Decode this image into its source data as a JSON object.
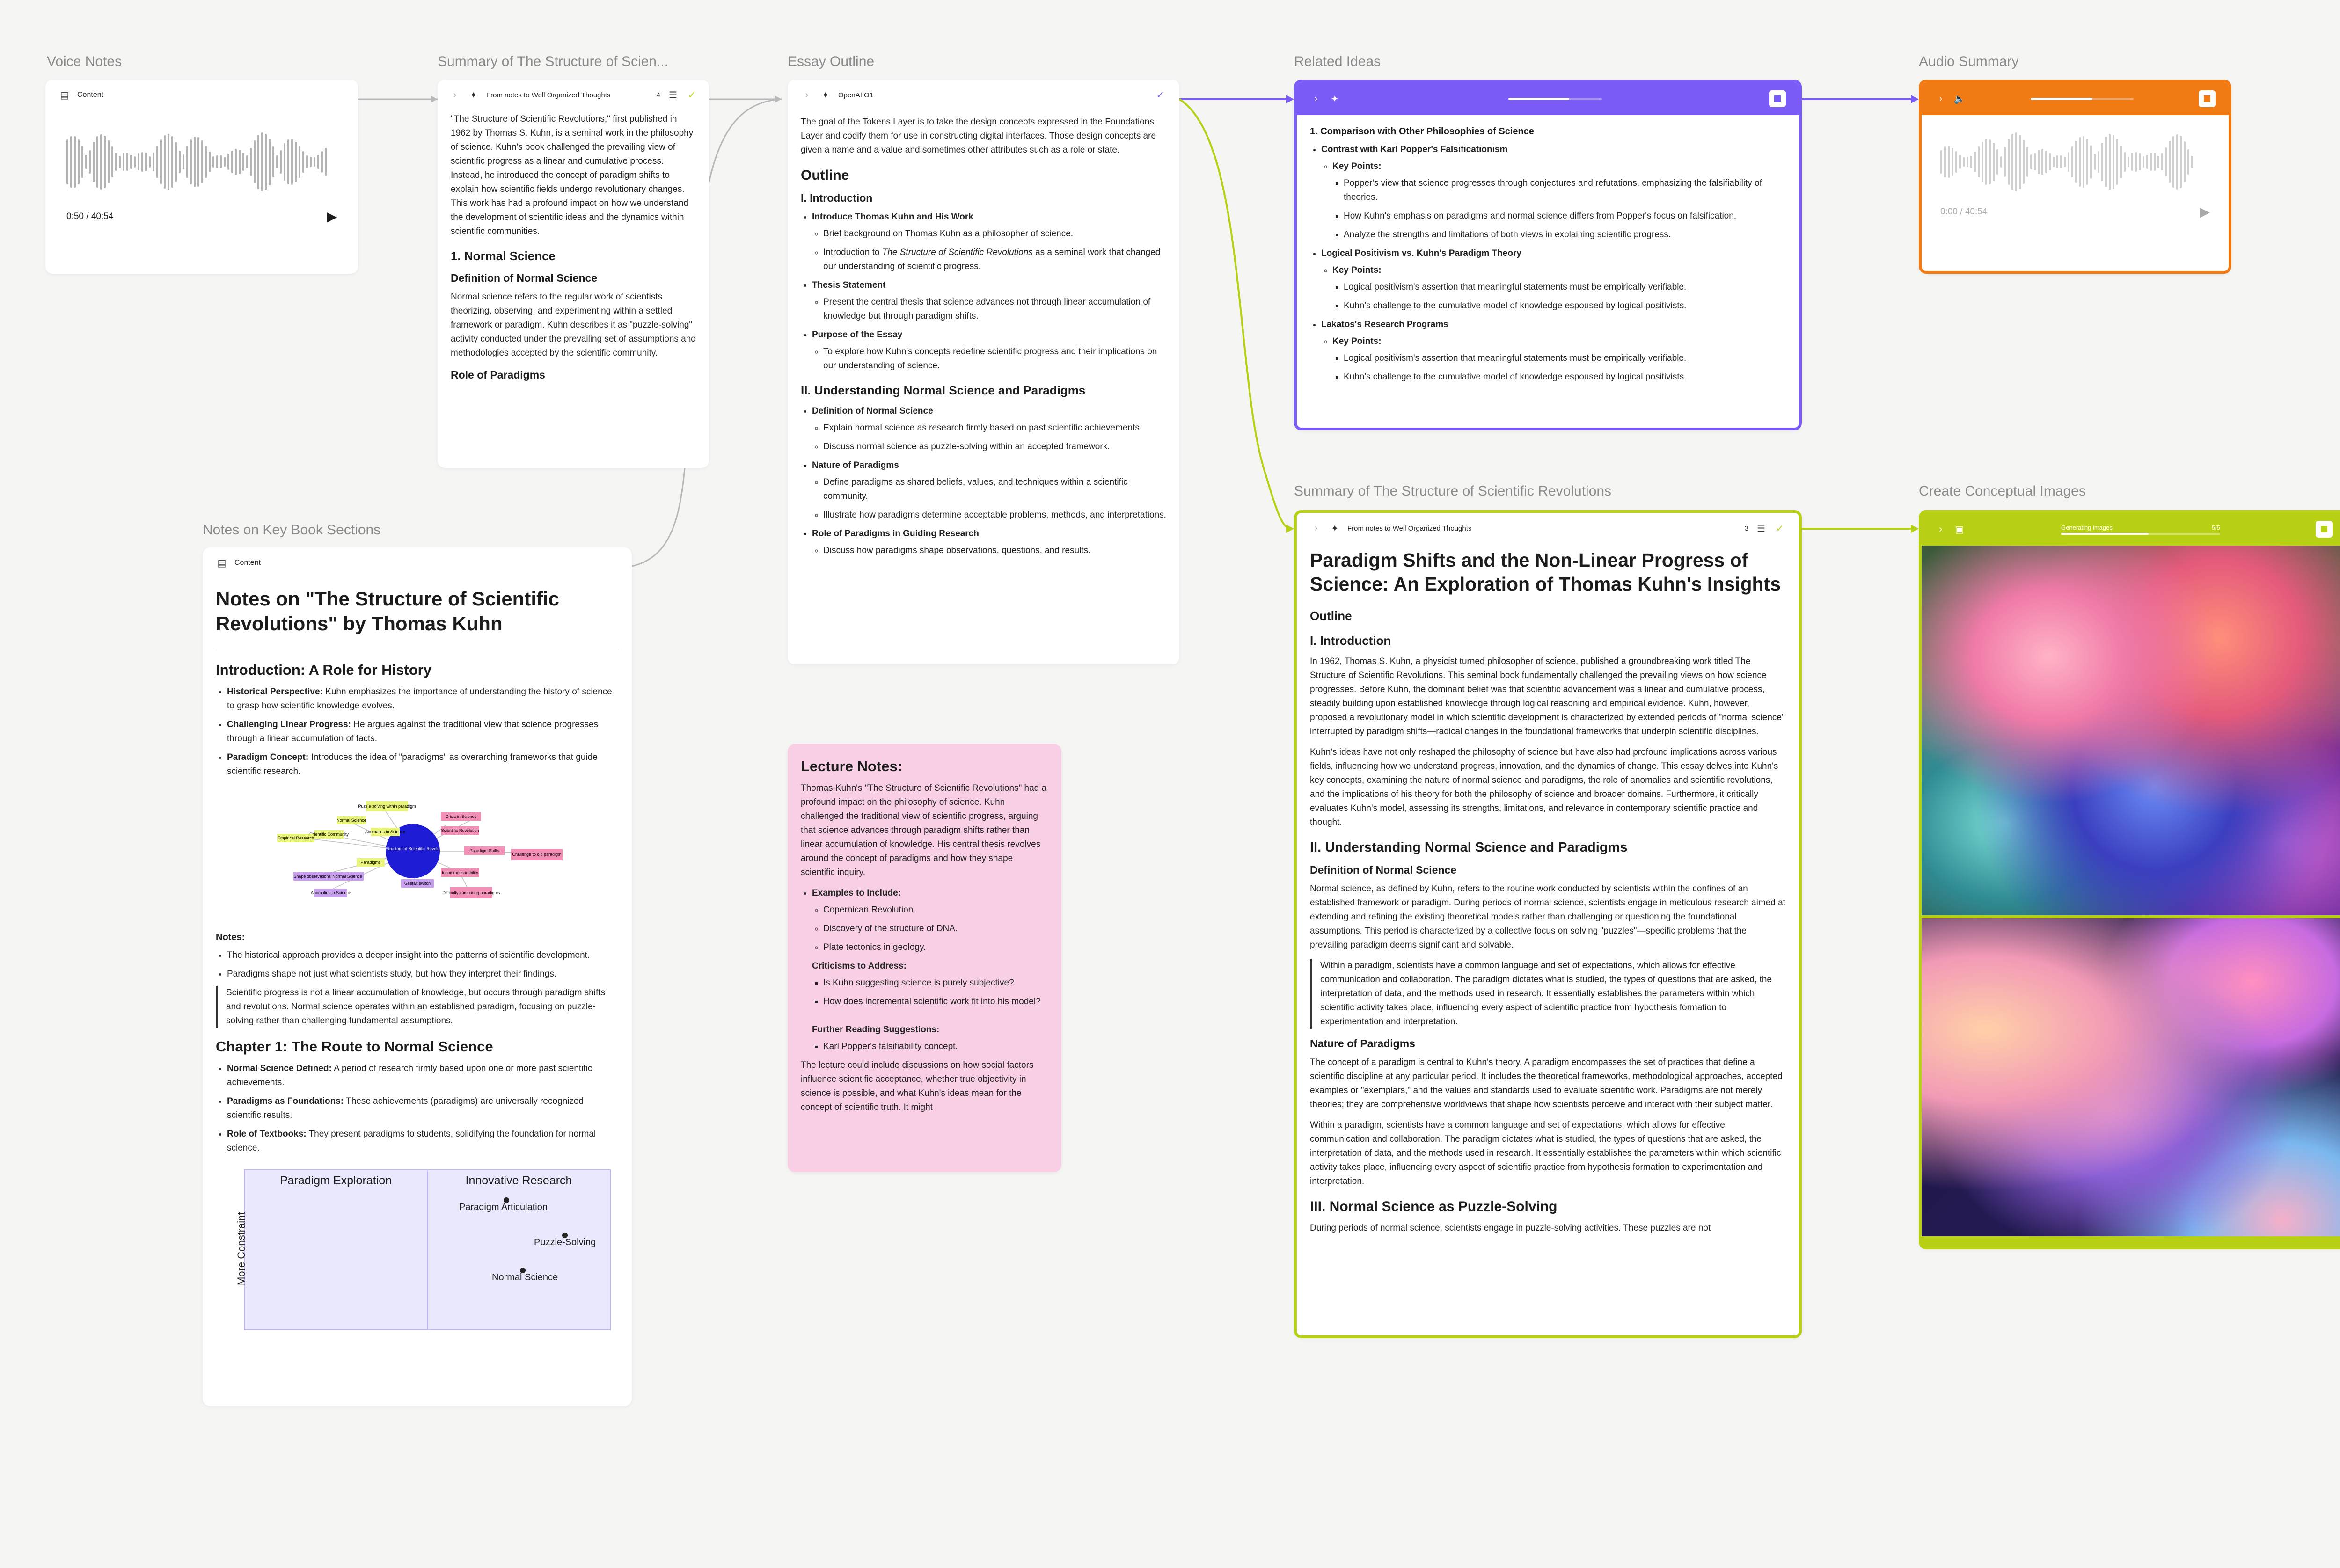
{
  "cards": {
    "voice_notes": {
      "label": "Voice Notes",
      "header": "Content",
      "time": "0:50 / 40:54"
    },
    "summary_small": {
      "label": "Summary of The Structure of Scien...",
      "header": "From notes to Well Organized Thoughts",
      "count": "4",
      "intro": "\"The Structure of Scientific Revolutions,\" first published in 1962 by Thomas S. Kuhn, is a seminal work in the philosophy of science. Kuhn's book challenged the prevailing view of scientific progress as a linear and cumulative process. Instead, he introduced the concept of paradigm shifts to explain how scientific fields undergo revolutionary changes. This work has had a profound impact on how we understand the development of scientific ideas and the dynamics within scientific communities.",
      "h_normal": "1. Normal Science",
      "h_def": "Definition of Normal Science",
      "def_text": "Normal science refers to the regular work of scientists theorizing, observing, and experimenting within a settled framework or paradigm. Kuhn describes it as \"puzzle-solving\" activity conducted under the prevailing set of assumptions and methodologies accepted by the scientific community.",
      "h_role": "Role of Paradigms"
    },
    "essay_outline": {
      "label": "Essay Outline",
      "header": "OpenAI O1",
      "intro": "The goal of the Tokens Layer is to take the design concepts expressed in the Foundations Layer and codify them for use in constructing digital interfaces. Those design concepts are given a name and a value and sometimes other attributes such as a role or state.",
      "h_outline": "Outline",
      "h_intro": "I. Introduction",
      "i1": "Introduce Thomas Kuhn and His Work",
      "i1a": "Brief background on Thomas Kuhn as a philosopher of science.",
      "i1b_pre": "Introduction to ",
      "i1b_em": "The Structure of Scientific Revolutions",
      "i1b_post": " as a seminal work that changed our understanding of scientific progress.",
      "i2": "Thesis Statement",
      "i2a": "Present the central thesis that science advances not through linear accumulation of knowledge but through paradigm shifts.",
      "i3": "Purpose of the Essay",
      "i3a": "To explore how Kuhn's concepts redefine scientific progress and their implications on our understanding of science.",
      "h_ii": "II. Understanding Normal Science and Paradigms",
      "j1": "Definition of Normal Science",
      "j1a": "Explain normal science as research firmly based on past scientific achievements.",
      "j1b": "Discuss normal science as puzzle-solving within an accepted framework.",
      "j2": "Nature of Paradigms",
      "j2a": "Define paradigms as shared beliefs, values, and techniques within a scientific community.",
      "j2b": "Illustrate how paradigms determine acceptable problems, methods, and interpretations.",
      "j3": "Role of Paradigms in Guiding Research",
      "j3a": "Discuss how paradigms shape observations, questions, and results."
    },
    "related_ideas": {
      "label": "Related Ideas",
      "t1": "1. Comparison with Other Philosophies of Science",
      "t1a": "Contrast with Karl Popper's Falsificationism",
      "kp": "Key Points:",
      "t1a1": "Popper's view that science progresses through conjectures and refutations, emphasizing the falsifiability of theories.",
      "t1a2": "How Kuhn's emphasis on paradigms and normal science differs from Popper's focus on falsification.",
      "t1a3": "Analyze the strengths and limitations of both views in explaining scientific progress.",
      "t1b": "Logical Positivism vs. Kuhn's Paradigm Theory",
      "t1b1": "Logical positivism's assertion that meaningful statements must be empirically verifiable.",
      "t1b2": "Kuhn's challenge to the cumulative model of knowledge espoused by logical positivists.",
      "t1c": "Lakatos's Research Programs",
      "t1c1": "Logical positivism's assertion that meaningful statements must be empirically verifiable.",
      "t1c2": "Kuhn's challenge to the cumulative model of knowledge espoused by logical positivists."
    },
    "audio_summary": {
      "label": "Audio Summary",
      "time": "0:00 / 40:54"
    },
    "notes_book": {
      "label": "Notes on Key Book Sections",
      "header": "Content",
      "title": "Notes on \"The Structure of Scientific Revolutions\" by Thomas Kuhn",
      "h_intro": "Introduction: A Role for History",
      "b1k": "Historical Perspective:",
      "b1v": " Kuhn emphasizes the importance of understanding the history of science to grasp how scientific knowledge evolves.",
      "b2k": "Challenging Linear Progress:",
      "b2v": " He argues against the traditional view that science progresses through a linear accumulation of facts.",
      "b3k": "Paradigm Concept:",
      "b3v": " Introduces the idea of \"paradigms\" as overarching frameworks that guide scientific research.",
      "notes_h": "Notes:",
      "n1": "The historical approach provides a deeper insight into the patterns of scientific development.",
      "n2": "Paradigms shape not just what scientists study, but how they interpret their findings.",
      "quote": "Scientific progress is not a linear accumulation of knowledge, but occurs through paradigm shifts and revolutions. Normal science operates within an established paradigm, focusing on puzzle-solving rather than challenging fundamental assumptions.",
      "h_ch1": "Chapter 1: The Route to Normal Science",
      "c1k": "Normal Science Defined:",
      "c1v": " A period of research firmly based upon one or more past scientific achievements.",
      "c2k": "Paradigms as Foundations:",
      "c2v": " These achievements (paradigms) are universally recognized scientific results.",
      "c3k": "Role of Textbooks:",
      "c3v": " They present paradigms to students, solidifying the foundation for normal science.",
      "matrix": {
        "col1": "Paradigm Exploration",
        "col2": "Innovative Research",
        "ylabel": "More Constraint",
        "p1": "Paradigm Articulation",
        "p2": "Puzzle-Solving",
        "p3": "Normal Science"
      },
      "mindmap": {
        "center": "The Structure of Scientific Revolutions",
        "n_a": "Puzzle solving within paradigm",
        "n_b": "Normal Science",
        "n_c": "Anomalies in Science",
        "n_d": "Scientific Community",
        "n_e": "Empirical Research",
        "n_f": "Paradigms",
        "n_g": "Shape observations",
        "n_h": "Crisis in Science",
        "n_i": "Paradigm Shifts",
        "n_j": "Scientific Revolution",
        "n_k": "Challenge to old paradigm",
        "n_l": "Incommensurability",
        "n_m": "Difficulty comparing paradigms",
        "n_n": "Gestalt switch"
      }
    },
    "lecture": {
      "title": "Lecture Notes:",
      "intro": "Thomas Kuhn's \"The Structure of Scientific Revolutions\" had a profound impact on the philosophy of science. Kuhn challenged the traditional view of scientific progress, arguing that science advances through paradigm shifts rather than linear accumulation of knowledge. His central thesis revolves around the concept of paradigms and how they shape scientific inquiry.",
      "ex_h": "Examples to Include:",
      "ex1": "Copernican Revolution.",
      "ex2": "Discovery of the structure of DNA.",
      "ex3": "Plate tectonics in geology.",
      "cr_h": "Criticisms to Address:",
      "cr1": "Is Kuhn suggesting science is purely subjective?",
      "cr2": "How does incremental scientific work fit into his model?",
      "fr_h": "Further Reading Suggestions:",
      "fr1": "Karl Popper's falsifiability concept.",
      "outro": "The lecture could include discussions on how social factors influence scientific acceptance, whether true objectivity in science is possible, and what Kuhn's ideas mean for the concept of scientific truth. It might"
    },
    "summary_big": {
      "label": "Summary of The Structure of Scientific Revolutions",
      "header": "From notes to Well Organized Thoughts",
      "count": "3",
      "title": "Paradigm Shifts and the Non-Linear Progress of Science: An Exploration of Thomas Kuhn's Insights",
      "h_outline": "Outline",
      "h_intro": "I. Introduction",
      "p1": "In 1962, Thomas S. Kuhn, a physicist turned philosopher of science, published a groundbreaking work titled The Structure of Scientific Revolutions. This seminal book fundamentally challenged the prevailing views on how science progresses. Before Kuhn, the dominant belief was that scientific advancement was a linear and cumulative process, steadily building upon established knowledge through logical reasoning and empirical evidence. Kuhn, however, proposed a revolutionary model in which scientific development is characterized by extended periods of \"normal science\" interrupted by paradigm shifts—radical changes in the foundational frameworks that underpin scientific disciplines.",
      "p2": "Kuhn's ideas have not only reshaped the philosophy of science but have also had profound implications across various fields, influencing how we understand progress, innovation, and the dynamics of change. This essay delves into Kuhn's key concepts, examining the nature of normal science and paradigms, the role of anomalies and scientific revolutions, and the implications of his theory for both the philosophy of science and broader domains. Furthermore, it critically evaluates Kuhn's model, assessing its strengths, limitations, and relevance in contemporary scientific practice and thought.",
      "h_ii": "II. Understanding Normal Science and Paradigms",
      "h_def": "Definition of Normal Science",
      "p3": "Normal science, as defined by Kuhn, refers to the routine work conducted by scientists within the confines of an established framework or paradigm. During periods of normal science, scientists engage in meticulous research aimed at extending and refining the existing theoretical models rather than challenging or questioning the foundational assumptions. This period is characterized by a collective focus on solving \"puzzles\"—specific problems that the prevailing paradigm deems significant and solvable.",
      "q1": "Within a paradigm, scientists have a common language and set of expectations, which allows for effective communication and collaboration. The paradigm dictates what is studied, the types of questions that are asked, the interpretation of data, and the methods used in research. It essentially establishes the parameters within which scientific activity takes place, influencing every aspect of scientific practice from hypothesis formation to experimentation and interpretation.",
      "h_nat": "Nature of Paradigms",
      "p4": "The concept of a paradigm is central to Kuhn's theory. A paradigm encompasses the set of practices that define a scientific discipline at any particular period. It includes the theoretical frameworks, methodological approaches, accepted examples or \"exemplars,\" and the values and standards used to evaluate scientific work. Paradigms are not merely theories; they are comprehensive worldviews that shape how scientists perceive and interact with their subject matter.",
      "p5": "Within a paradigm, scientists have a common language and set of expectations, which allows for effective communication and collaboration. The paradigm dictates what is studied, the types of questions that are asked, the interpretation of data, and the methods used in research. It essentially establishes the parameters within which scientific activity takes place, influencing every aspect of scientific practice from hypothesis formation to experimentation and interpretation.",
      "h_iii": "III. Normal Science as Puzzle-Solving",
      "p6": "During periods of normal science, scientists engage in puzzle-solving activities. These puzzles are not"
    },
    "images": {
      "label": "Create Conceptual Images",
      "status": "Generating images",
      "count": "5/5",
      "progress": 0.55
    }
  },
  "colors": {
    "purple": "#7b5cf6",
    "orange": "#f27a12",
    "lime": "#b8d013",
    "pink": "#f8cfe4"
  }
}
